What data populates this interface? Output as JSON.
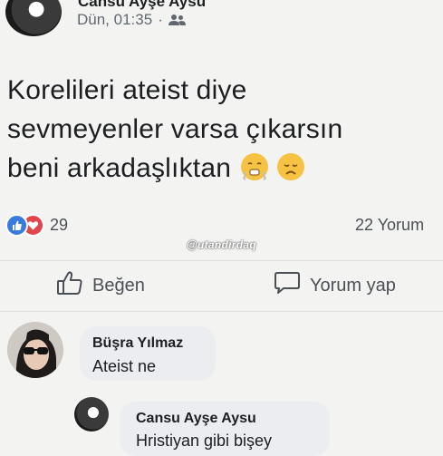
{
  "post": {
    "author": "Cansu Ayşe Aysu",
    "time": "Dün, 01:35",
    "separator": "·",
    "audience_icon": "friends-icon",
    "text_line1": "Korelileri ateist diye",
    "text_line2": "sevmeyenler varsa  çıkarsın",
    "text_line3": "beni arkadaşlıktan",
    "emojis": [
      "steam-from-nose-emoji",
      "disappointed-face-emoji"
    ]
  },
  "reactions": {
    "icons": [
      "like-reaction-icon",
      "love-reaction-icon"
    ],
    "count": "29",
    "comments": "22 Yorum"
  },
  "watermark": "@utandirdaq",
  "actions": {
    "like_label": "Beğen",
    "comment_label": "Yorum yap"
  },
  "comments": [
    {
      "author": "Büşra Yılmaz",
      "text": "Ateist ne"
    },
    {
      "author": "Cansu Ayşe Aysu",
      "text": "Hristiyan gibi bişey"
    }
  ],
  "colors": {
    "background": "#f3f4f2",
    "like_blue": "#3a7be0",
    "love_red": "#e2464d",
    "bubble": "#ebedf0",
    "emoji_yellow": "#f6c243"
  }
}
